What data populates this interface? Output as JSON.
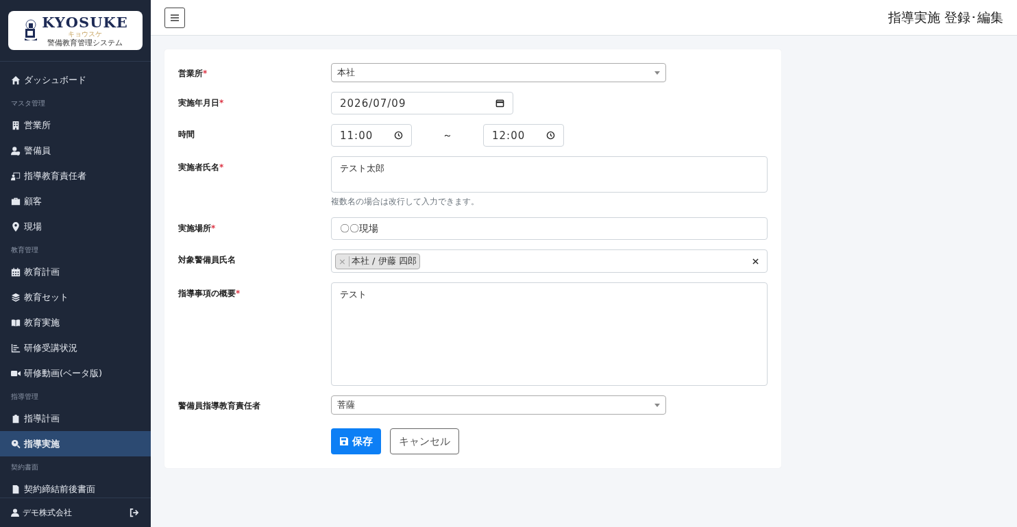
{
  "logo": {
    "wordmark": "KYOSUKE",
    "kana": "キョウスケ",
    "tagline": "警備教育管理システム"
  },
  "sidebar": {
    "items": [
      {
        "kind": "link",
        "label": "ダッシュボード",
        "selected": false
      },
      {
        "kind": "section",
        "label": "マスタ管理"
      },
      {
        "kind": "link",
        "label": "営業所",
        "selected": false
      },
      {
        "kind": "link",
        "label": "警備員",
        "selected": false
      },
      {
        "kind": "link",
        "label": "指導教育責任者",
        "selected": false
      },
      {
        "kind": "link",
        "label": "顧客",
        "selected": false
      },
      {
        "kind": "link",
        "label": "現場",
        "selected": false
      },
      {
        "kind": "section",
        "label": "教育管理"
      },
      {
        "kind": "link",
        "label": "教育計画",
        "selected": false
      },
      {
        "kind": "link",
        "label": "教育セット",
        "selected": false
      },
      {
        "kind": "link",
        "label": "教育実施",
        "selected": false
      },
      {
        "kind": "link",
        "label": "研修受講状況",
        "selected": false
      },
      {
        "kind": "link",
        "label": "研修動画(ベータ版)",
        "selected": false
      },
      {
        "kind": "section",
        "label": "指導管理"
      },
      {
        "kind": "link",
        "label": "指導計画",
        "selected": false
      },
      {
        "kind": "link",
        "label": "指導実施",
        "selected": true
      },
      {
        "kind": "section",
        "label": "契約書面"
      },
      {
        "kind": "link",
        "label": "契約締結前後書面",
        "selected": false
      }
    ],
    "user": "デモ株式会社"
  },
  "header": {
    "title": "指導実施 登録･編集"
  },
  "form": {
    "required_mark": "*",
    "tag_remove": "×",
    "fields": [
      {
        "kind": "select",
        "label": "営業所",
        "required": true,
        "value": "本社"
      },
      {
        "kind": "date",
        "label": "実施年月日",
        "required": true,
        "value": "2026/07/09"
      },
      {
        "kind": "timerange",
        "label": "時間",
        "required": false,
        "from": "11:00",
        "separator": "～",
        "to": "12:00"
      },
      {
        "kind": "textarea",
        "label": "実施者氏名",
        "required": true,
        "value": "テスト太郎",
        "help": "複数名の場合は改行して入力できます。"
      },
      {
        "kind": "text",
        "label": "実施場所",
        "required": true,
        "value": "〇〇現場"
      },
      {
        "kind": "tags",
        "label": "対象警備員氏名",
        "required": false,
        "tags": [
          "本社 / 伊藤 四郎"
        ]
      },
      {
        "kind": "bigtextarea",
        "label": "指導事項の概要",
        "required": true,
        "value": "テスト"
      },
      {
        "kind": "select",
        "label": "警備員指導教育責任者",
        "required": false,
        "value": "菩薩"
      }
    ],
    "buttons": {
      "save": "保存",
      "cancel": "キャンセル"
    }
  }
}
